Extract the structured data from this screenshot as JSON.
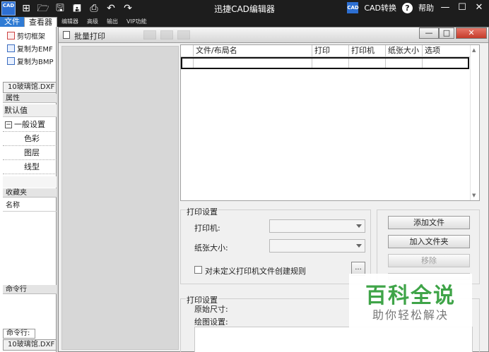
{
  "app": {
    "title": "迅捷CAD编辑器",
    "icon_label": "CAD",
    "cad_convert_badge": "CAD",
    "cad_convert_label": "CAD转换",
    "help_label": "帮助",
    "toolbar_icons": [
      "new-icon",
      "open-folder-icon",
      "save-icon",
      "save-as-icon",
      "print-icon",
      "undo-icon",
      "redo-icon"
    ]
  },
  "menu": {
    "items": [
      "文件",
      "查看器",
      "编辑器",
      "高级",
      "输出",
      "VIP功能"
    ]
  },
  "left_panel": {
    "actions": [
      "剪切框架",
      "复制为EMF",
      "复制为BMP"
    ],
    "file_tab": "10玻璃馆.DXF",
    "properties_header": "属性",
    "default_value": "默认值",
    "general_settings": "一般设置",
    "tree_items": [
      "色彩",
      "图层",
      "线型"
    ],
    "favorites_header": "收藏夹",
    "name_column": "名称",
    "command_header": "命令行",
    "command_label": "命令行:",
    "bottom_file": "10玻璃馆.DXF"
  },
  "dialog": {
    "title": "批量打印",
    "table": {
      "columns": [
        "",
        "文件/布局名",
        "打印",
        "打印机",
        "纸张大小",
        "选项"
      ]
    },
    "print_settings": {
      "title": "打印设置",
      "printer_label": "打印机:",
      "paper_label": "纸张大小:",
      "checkbox_label": "对未定义打印机文件创建规则",
      "ellipsis": "..."
    },
    "buttons": {
      "add_file": "添加文件",
      "add_folder": "加入文件夹",
      "remove": "移除"
    },
    "print_settings2": {
      "title": "打印设置",
      "original_size_label": "原始尺寸:",
      "drawing_settings_label": "绘图设置:"
    }
  },
  "watermark": {
    "title": "百科全说",
    "subtitle": "助你轻松解决"
  }
}
